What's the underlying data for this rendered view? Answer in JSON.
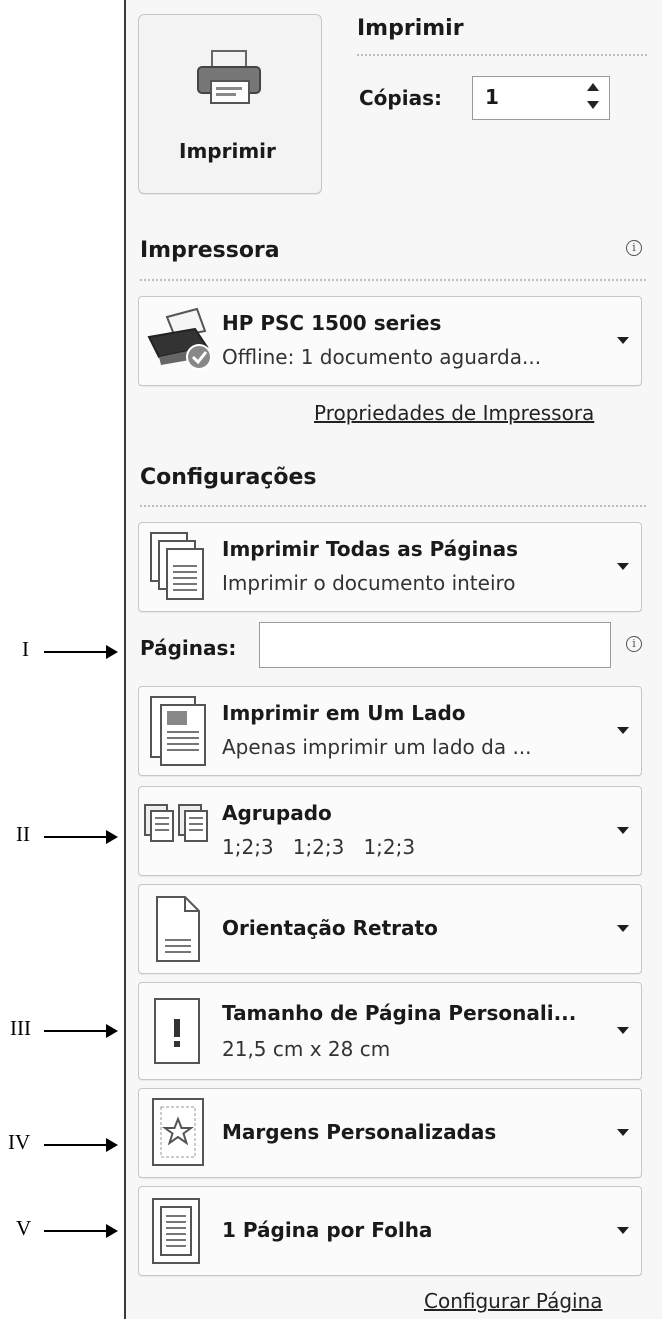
{
  "print": {
    "button_label": "Imprimir",
    "heading": "Imprimir",
    "copies_label": "Cópias:",
    "copies_value": "1"
  },
  "printer": {
    "heading": "Impressora",
    "name": "HP PSC 1500 series",
    "status": "Offline: 1 documento aguarda...",
    "properties_link": "Propriedades de Impressora"
  },
  "settings": {
    "heading": "Configurações",
    "range": {
      "title": "Imprimir Todas as Páginas",
      "subtitle": "Imprimir o documento inteiro"
    },
    "pages_label": "Páginas:",
    "pages_value": "",
    "sides": {
      "title": "Imprimir em Um Lado",
      "subtitle": "Apenas imprimir um lado da ..."
    },
    "collate": {
      "title": "Agrupado",
      "subtitle": "1;2;3   1;2;3   1;2;3"
    },
    "orientation": {
      "title": "Orientação Retrato"
    },
    "paper_size": {
      "title": "Tamanho de Página Personali...",
      "subtitle": "21,5 cm x 28 cm"
    },
    "margins": {
      "title": "Margens Personalizadas"
    },
    "per_sheet": {
      "title": "1 Página por Folha"
    },
    "page_setup_link": "Configurar Página"
  },
  "annotations": [
    "I",
    "II",
    "III",
    "IV",
    "V"
  ]
}
